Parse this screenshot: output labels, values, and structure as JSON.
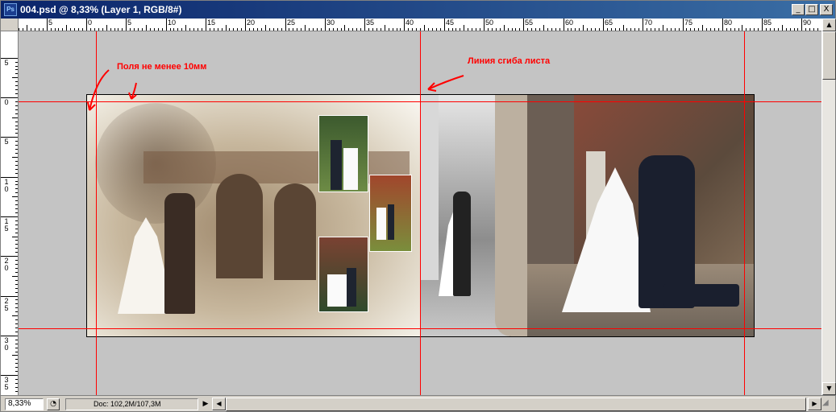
{
  "window": {
    "title": "004.psd @ 8,33% (Layer 1, RGB/8#)",
    "app_icon_label": "Ps",
    "minimize_label": "_",
    "maximize_label": "□",
    "close_label": "X"
  },
  "ruler_top": {
    "labels": [
      "5",
      "0",
      "5",
      "10",
      "15",
      "20",
      "25",
      "30",
      "35",
      "40",
      "45",
      "50",
      "55",
      "60",
      "65",
      "70",
      "75",
      "80",
      "85",
      "90"
    ]
  },
  "ruler_left": {
    "labels": [
      "5",
      "0",
      "5",
      "10",
      "15",
      "20",
      "25",
      "30",
      "35"
    ]
  },
  "annotations": {
    "margins_text": "Поля не менее 10мм",
    "fold_text": "Линия сгиба листа",
    "color": "#ff0000"
  },
  "status": {
    "zoom": "8,33%",
    "doc_info": "Doc: 102,2M/107,3M",
    "menu_arrow": "▶"
  },
  "scroll": {
    "up": "▲",
    "down": "▼",
    "left": "◀",
    "right": "▶"
  }
}
